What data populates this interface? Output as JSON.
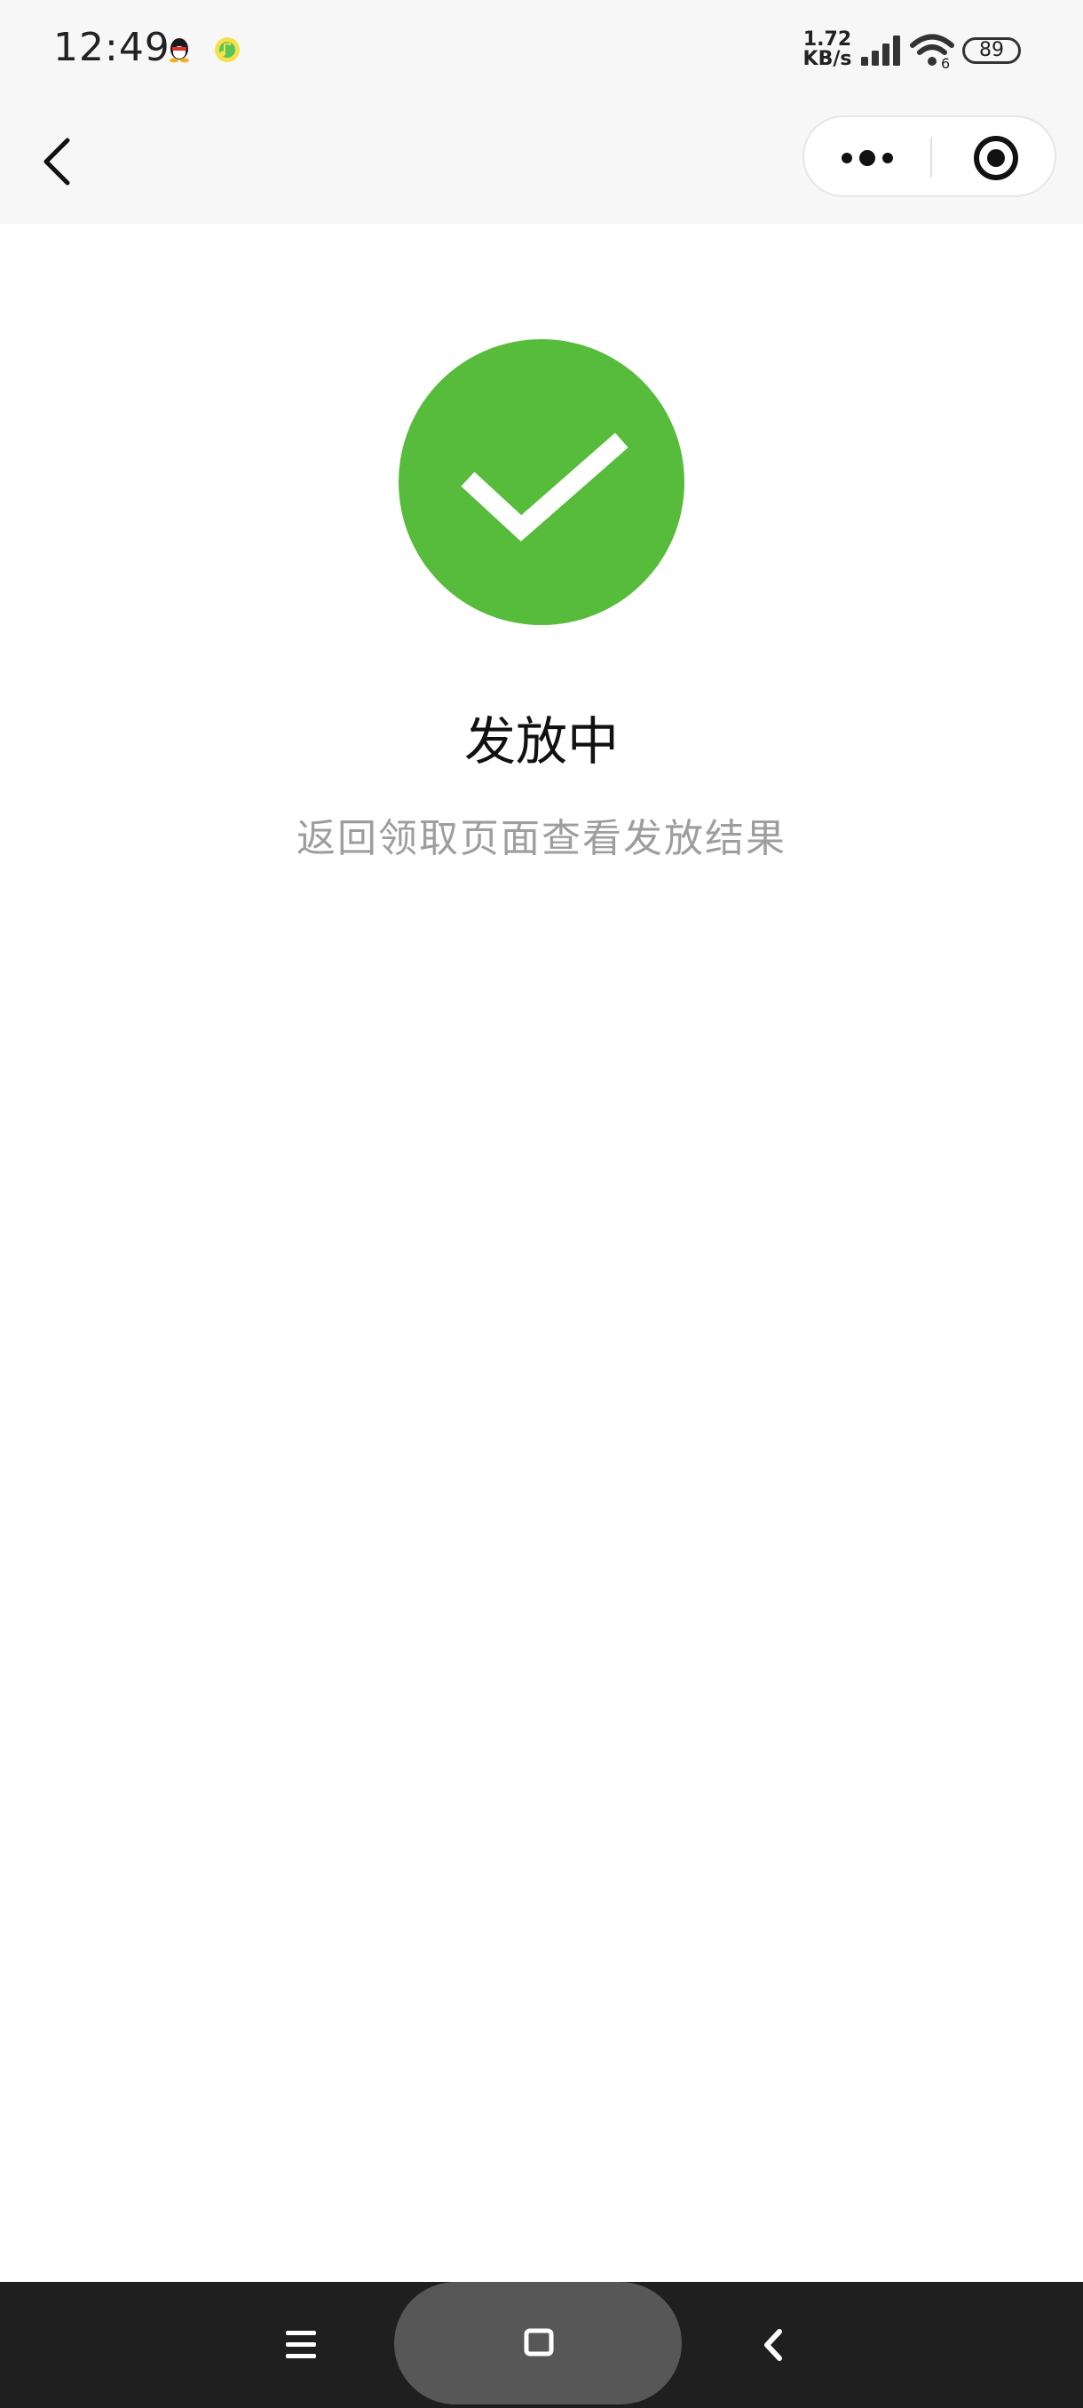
{
  "status_bar": {
    "time": "12:49",
    "notifications": [
      "qq-icon",
      "music-app-icon"
    ],
    "net_speed_value": "1.72",
    "net_speed_unit": "KB/s",
    "signal": "signal-icon",
    "wifi_sub": "6",
    "battery": "89"
  },
  "nav": {
    "back_icon": "chevron-left-icon",
    "more_icon": "more-dots-icon",
    "close_icon": "target-close-icon"
  },
  "result": {
    "icon": "check-circle-icon",
    "color": "#57bb3c",
    "title": "发放中",
    "description": "返回领取页面查看发放结果"
  },
  "system_nav": {
    "menu_icon": "hamburger-icon",
    "home_icon": "square-home-icon",
    "back_icon": "chevron-left-icon"
  }
}
